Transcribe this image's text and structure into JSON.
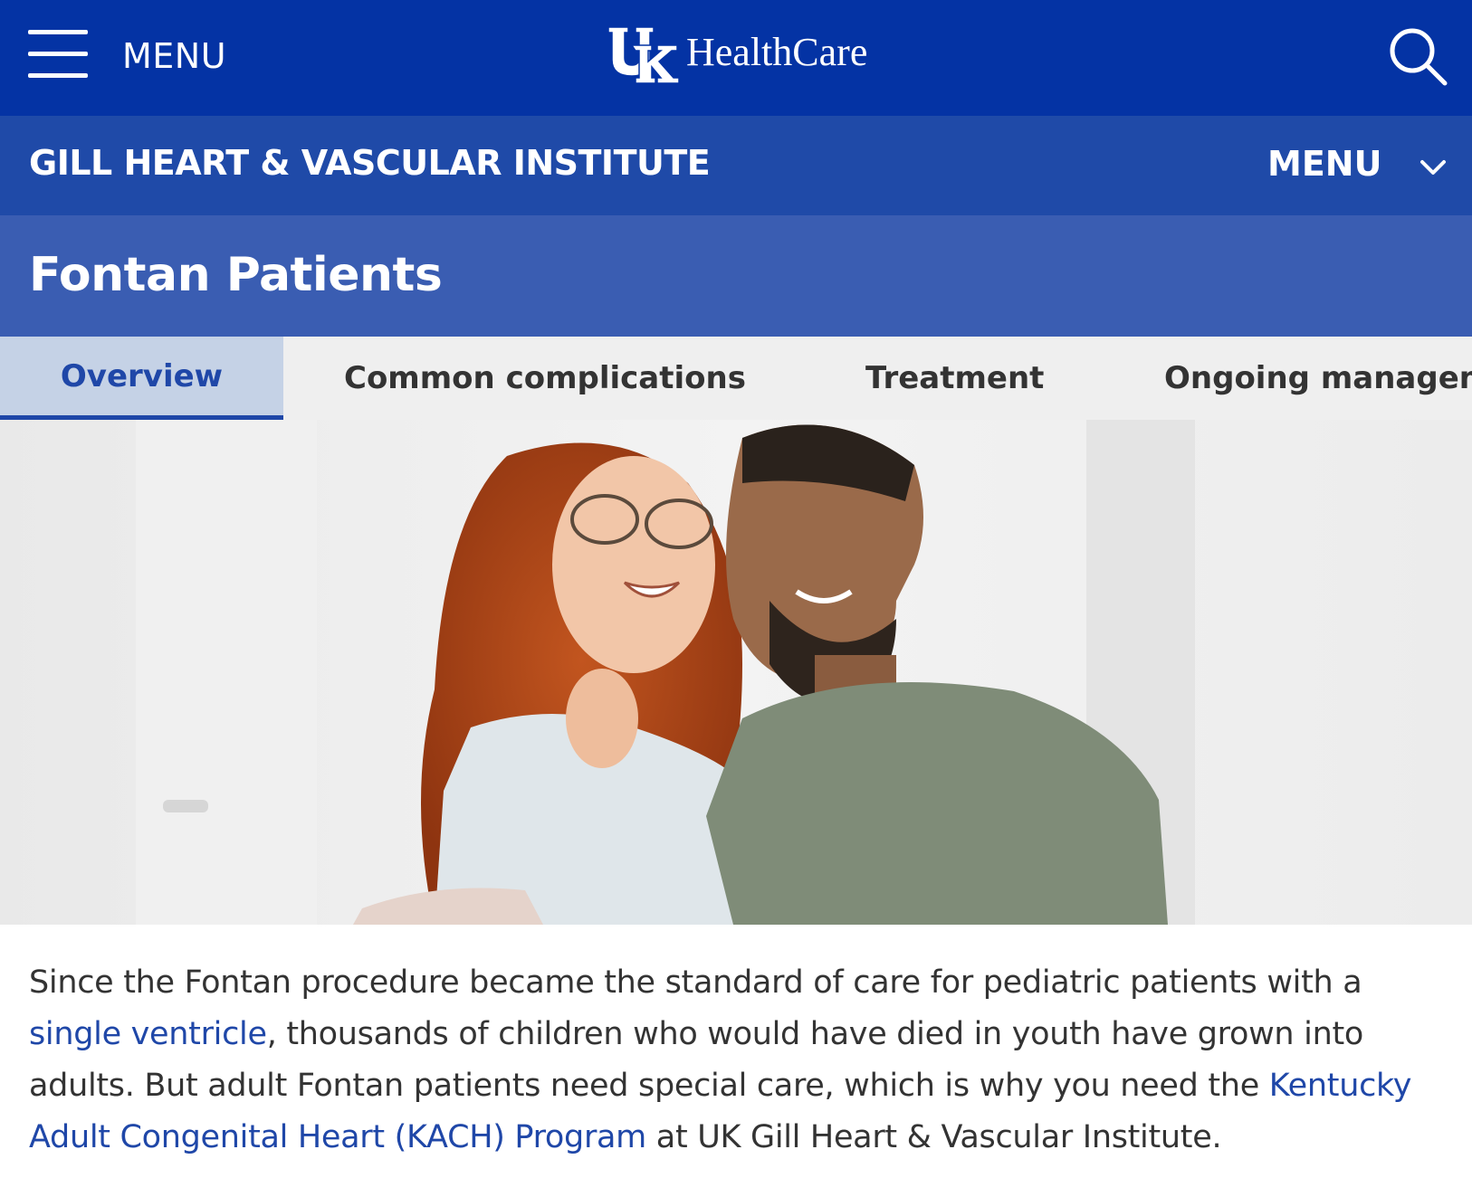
{
  "header": {
    "menu_label": "MENU",
    "logo_text": "HealthCare",
    "logo_mark": "UK",
    "menu_icon": "hamburger-icon",
    "search_icon": "search-icon",
    "background_color": "#0433a4"
  },
  "institute_bar": {
    "title": "GILL HEART & VASCULAR INSTITUTE",
    "menu_label": "MENU",
    "menu_icon": "chevron-down-icon",
    "background_color": "#1f4aa8"
  },
  "page": {
    "title": "Fontan Patients",
    "background_color": "#3a5db2"
  },
  "tabs": [
    {
      "label": "Overview",
      "active": true
    },
    {
      "label": "Common complications",
      "active": false
    },
    {
      "label": "Treatment",
      "active": false
    },
    {
      "label": "Ongoing managem",
      "active": false
    }
  ],
  "intro": {
    "text_1": "Since the Fontan procedure became the standard of care for pediatric patients with a ",
    "link_1": "single ventricle",
    "text_2": ", thousands of children who would have died in youth have grown into adults. But adult Fontan patients need special care, which is why you need the ",
    "link_2": "Kentucky Adult Congenital Heart (KACH) Program",
    "text_3": " at UK Gill Heart & Vascular Institute."
  },
  "colors": {
    "accent": "#1f47a8",
    "active_tab_bg": "#c5d2e6",
    "tab_bar_bg": "#efefef"
  }
}
